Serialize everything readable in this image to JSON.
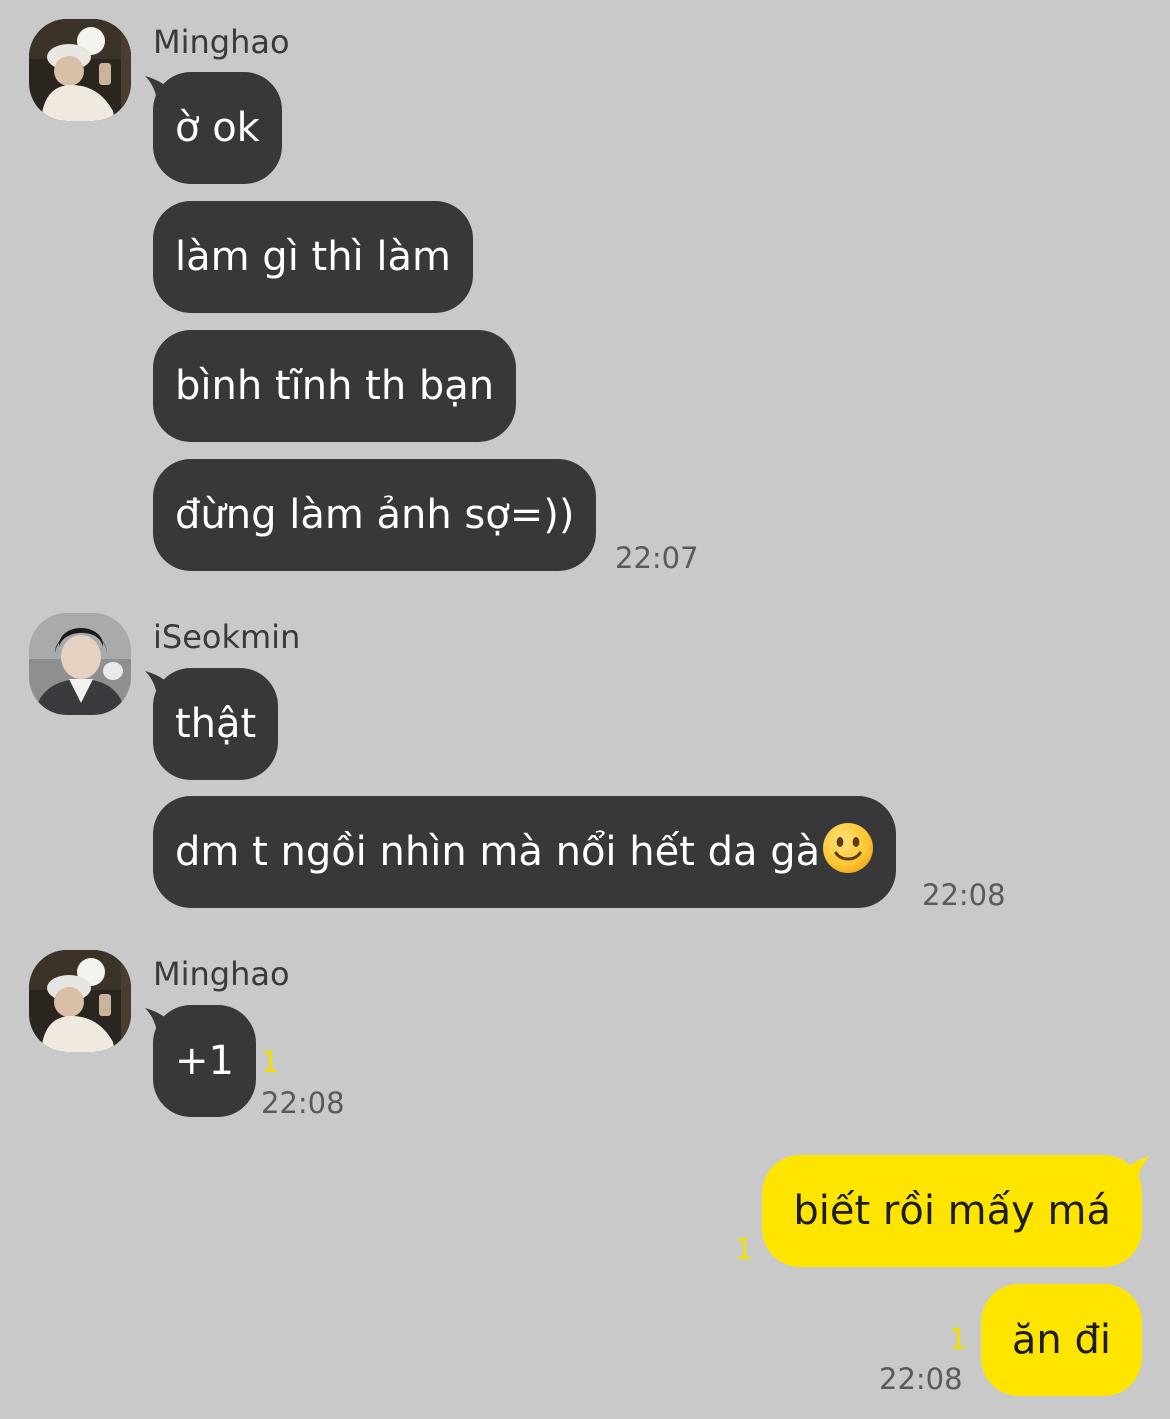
{
  "colors": {
    "background": "#c9c9c9",
    "incoming_bubble": "#38383a",
    "outgoing_bubble": "#fee500",
    "unread_count": "#f2de00"
  },
  "groups": [
    {
      "sender": "Minghao",
      "avatar": "profile-photo",
      "messages": [
        "ờ ok",
        "làm gì thì làm",
        "bình tĩnh th bạn",
        "đừng làm ảnh sợ=))"
      ],
      "time": "22:07"
    },
    {
      "sender": "iSeokmin",
      "avatar": "profile-photo",
      "messages": [
        "thật",
        "dm t ngồi nhìn mà nổi hết da gà"
      ],
      "emoji": "slightly-smiling-face-icon",
      "time": "22:08"
    },
    {
      "sender": "Minghao",
      "avatar": "profile-photo",
      "messages": [
        "+1"
      ],
      "unread": "1",
      "time": "22:08"
    }
  ],
  "outgoing": {
    "messages": [
      {
        "text": "biết rồi mấy má",
        "unread": "1"
      },
      {
        "text": "ăn đi",
        "unread": "1"
      }
    ],
    "time": "22:08"
  }
}
